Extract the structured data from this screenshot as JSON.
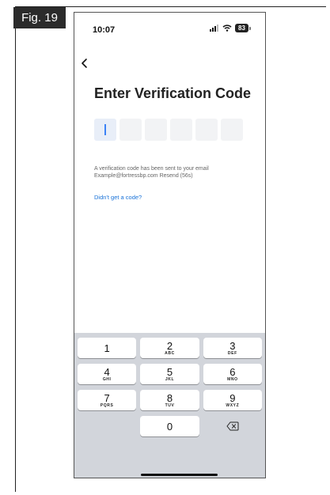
{
  "figure": {
    "label": "Fig. 19"
  },
  "status_bar": {
    "time": "10:07",
    "battery": "83"
  },
  "header": {
    "back_icon": "chevron-left-icon",
    "title": "Enter Verification Code"
  },
  "code_input": {
    "length": 6,
    "active_index": 0
  },
  "info": {
    "line1": "A verification code has been sent to your email",
    "line2": "Example@fortressbp.com  Resend (56s)"
  },
  "links": {
    "no_code": "Didn't get a code?"
  },
  "keypad": {
    "keys": [
      {
        "digit": "1",
        "letters": ""
      },
      {
        "digit": "2",
        "letters": "ABC"
      },
      {
        "digit": "3",
        "letters": "DEF"
      },
      {
        "digit": "4",
        "letters": "GHI"
      },
      {
        "digit": "5",
        "letters": "JKL"
      },
      {
        "digit": "6",
        "letters": "MNO"
      },
      {
        "digit": "7",
        "letters": "PQRS"
      },
      {
        "digit": "8",
        "letters": "TUV"
      },
      {
        "digit": "9",
        "letters": "WXYZ"
      },
      {
        "digit": "",
        "letters": ""
      },
      {
        "digit": "0",
        "letters": ""
      },
      {
        "digit": "",
        "letters": "",
        "icon": "delete-backspace-icon"
      }
    ]
  }
}
